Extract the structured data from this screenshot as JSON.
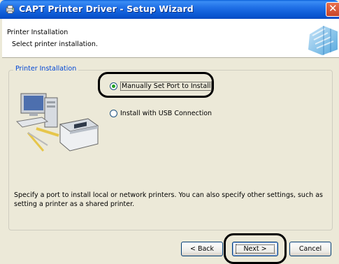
{
  "window": {
    "title": "CAPT Printer Driver - Setup Wizard",
    "close_glyph": "✕"
  },
  "header": {
    "title": "Printer Installation",
    "subtitle": "Select printer installation."
  },
  "group": {
    "label": "Printer Installation"
  },
  "options": [
    {
      "label": "Manually Set Port to Install",
      "selected": true
    },
    {
      "label": "Install with USB Connection",
      "selected": false
    }
  ],
  "description": "Specify a port to install local or network printers. You can also specify other settings, such as setting a printer as a shared printer.",
  "buttons": {
    "back": "< Back",
    "next": "Next >",
    "cancel": "Cancel"
  },
  "icons": [
    "printer-setup-icon",
    "close-icon",
    "wizard-header-icon",
    "computer-printer-illustration"
  ]
}
